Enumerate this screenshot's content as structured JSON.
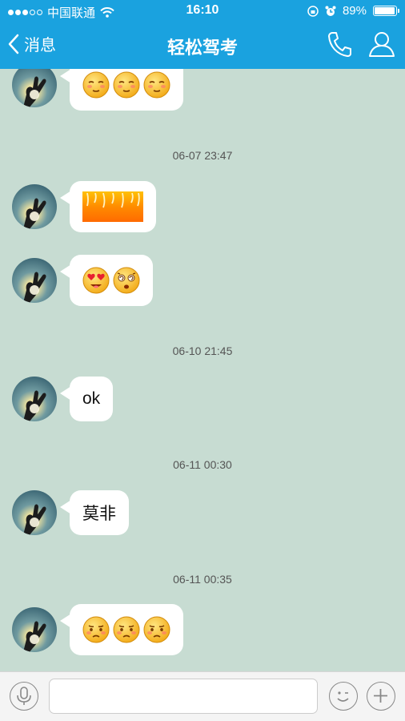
{
  "status": {
    "carrier": "中国联通",
    "time": "16:10",
    "battery": "89%",
    "battery_level": 0.89
  },
  "nav": {
    "back_label": "消息",
    "title": "轻松驾考"
  },
  "icons": {
    "back": "chevron-left-icon",
    "phone": "phone-icon",
    "profile": "person-icon",
    "mic": "microphone-icon",
    "emoji": "smiley-icon",
    "plus": "plus-icon"
  },
  "colors": {
    "header": "#1aa2df",
    "chat_bg": "#c7dcd2",
    "bubble": "#ffffff"
  },
  "messages": [
    {
      "type": "emoji",
      "content": [
        "blush-face",
        "blush-face",
        "blush-face"
      ]
    },
    {
      "type": "timestamp",
      "text": "06-07 23:47"
    },
    {
      "type": "sticker",
      "content": "orange-fire-image"
    },
    {
      "type": "emoji",
      "content": [
        "heart-eyes-face",
        "dizzy-face"
      ]
    },
    {
      "type": "timestamp",
      "text": "06-10 21:45"
    },
    {
      "type": "text",
      "text": "ok"
    },
    {
      "type": "timestamp",
      "text": "06-11 00:30"
    },
    {
      "type": "text",
      "text": "莫非"
    },
    {
      "type": "timestamp",
      "text": "06-11 00:35"
    },
    {
      "type": "emoji",
      "content": [
        "sad-face",
        "sad-face",
        "sad-face"
      ]
    }
  ],
  "input": {
    "value": "",
    "placeholder": ""
  }
}
